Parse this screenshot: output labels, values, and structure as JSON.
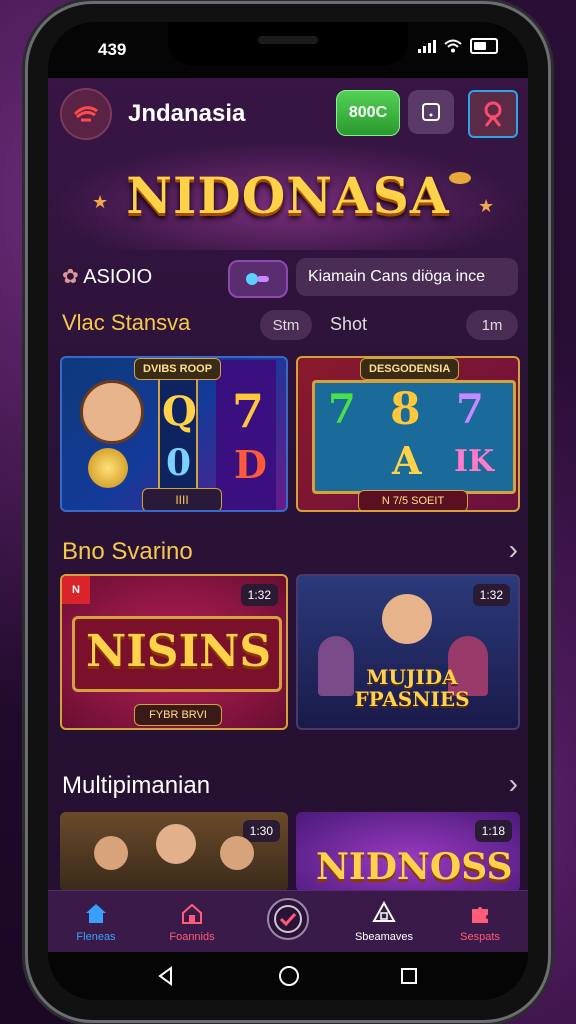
{
  "status": {
    "time": "439"
  },
  "header": {
    "app_name": "Jndanasia",
    "coin_label": "800C"
  },
  "banner": {
    "title": "NIDONASA"
  },
  "filter": {
    "casino_label": "ASIOIO",
    "search_text": "Kiamain Cans diöga ince"
  },
  "section1": {
    "title": "Vlac Stansva",
    "chip": "Stm",
    "label": "Shot",
    "count": "1m"
  },
  "cards1": [
    {
      "badge": "DVIBS ROOP",
      "symbols": [
        "Q",
        "7",
        "0",
        "D"
      ],
      "button": "IIII"
    },
    {
      "badge": "DESGODENSIA",
      "symbols": [
        "7",
        "8",
        "7",
        "A",
        "IK"
      ],
      "button": "N 7/5 SOEIT"
    }
  ],
  "section2": {
    "title": "Bno Svarino"
  },
  "cards2": [
    {
      "title": "NISINS",
      "subtitle": "FYBR BRVI",
      "count": "1:32",
      "tag": "N"
    },
    {
      "title": "MUJIDA FPASNIES",
      "count": "1:32"
    }
  ],
  "section3": {
    "title": "Multipimanian"
  },
  "cards3": [
    {
      "count": "1:30"
    },
    {
      "title": "NIDNOSS",
      "count": "1:18"
    }
  ],
  "tabs": [
    {
      "label": "Fleneas",
      "icon": "home-icon"
    },
    {
      "label": "Foannids",
      "icon": "house-icon"
    },
    {
      "label": "",
      "icon": "check-circle-icon"
    },
    {
      "label": "Sbeamaves",
      "icon": "triangle-cube-icon"
    },
    {
      "label": "Sespats",
      "icon": "puzzle-icon"
    }
  ],
  "colors": {
    "accent": "#f5c94a",
    "coin": "#3fba42",
    "tab_active": "#3aa0ff",
    "tab_red": "#ff5c7a"
  }
}
